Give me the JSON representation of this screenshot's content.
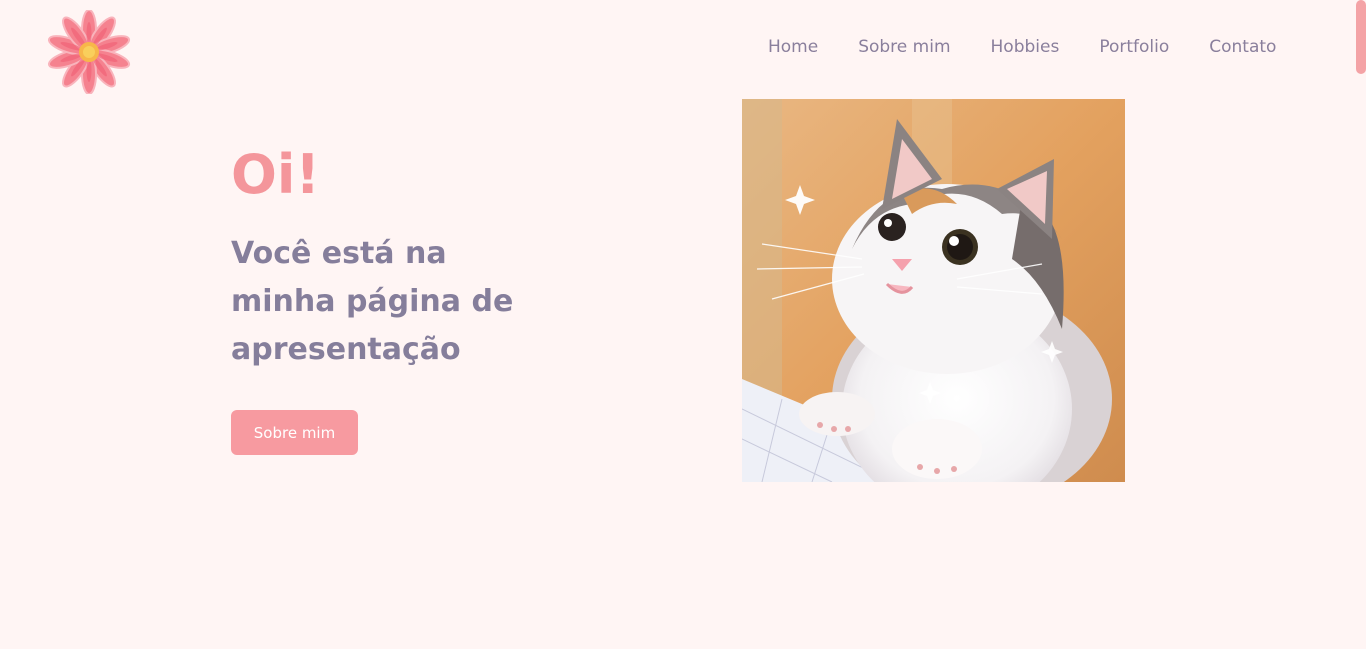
{
  "nav": {
    "items": [
      {
        "label": "Home"
      },
      {
        "label": "Sobre mim"
      },
      {
        "label": "Hobbies"
      },
      {
        "label": "Portfolio"
      },
      {
        "label": "Contato"
      }
    ]
  },
  "hero": {
    "greeting": "Oi!",
    "subtitle": "Você está na minha página de apresentação",
    "button_label": "Sobre mim"
  },
  "icons": {
    "logo": "flower-icon",
    "photo": "cat-photo"
  },
  "colors": {
    "background": "#fff5f4",
    "accent": "#f4969b",
    "text": "#857e9b",
    "button": "#f79aa0"
  }
}
